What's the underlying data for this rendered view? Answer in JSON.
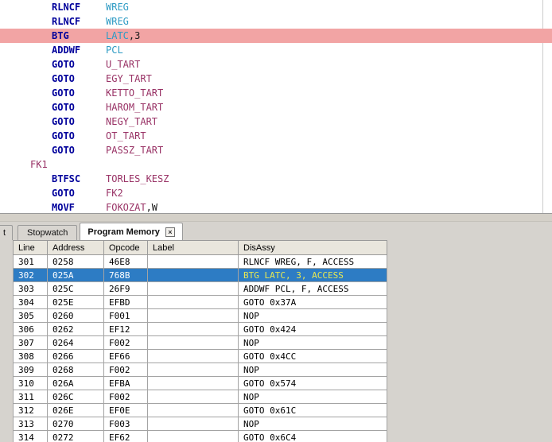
{
  "editor": {
    "lines": [
      {
        "opcode": "RLNCF",
        "operand": "WREG",
        "otype": "reg",
        "highlight": false
      },
      {
        "opcode": "RLNCF",
        "operand": "WREG",
        "otype": "reg",
        "highlight": false
      },
      {
        "opcode": "BTG",
        "operand": "LATC",
        "suffix": ",3",
        "otype": "reg",
        "highlight": true
      },
      {
        "opcode": "ADDWF",
        "operand": "PCL",
        "otype": "reg",
        "highlight": false
      },
      {
        "opcode": "GOTO",
        "operand": "U_TART",
        "otype": "lbl",
        "highlight": false
      },
      {
        "opcode": "GOTO",
        "operand": "EGY_TART",
        "otype": "lbl",
        "highlight": false
      },
      {
        "opcode": "GOTO",
        "operand": "KETTO_TART",
        "otype": "lbl",
        "highlight": false
      },
      {
        "opcode": "GOTO",
        "operand": "HAROM_TART",
        "otype": "lbl",
        "highlight": false
      },
      {
        "opcode": "GOTO",
        "operand": "NEGY_TART",
        "otype": "lbl",
        "highlight": false
      },
      {
        "opcode": "GOTO",
        "operand": "OT_TART",
        "otype": "lbl",
        "highlight": false
      },
      {
        "opcode": "GOTO",
        "operand": "PASSZ_TART",
        "otype": "lbl",
        "highlight": false
      },
      {
        "label": "FK1",
        "highlight": false
      },
      {
        "opcode": "BTFSC",
        "operand": "TORLES_KESZ",
        "otype": "lbl",
        "highlight": false
      },
      {
        "opcode": "GOTO",
        "operand": "FK2",
        "otype": "lbl",
        "highlight": false
      },
      {
        "opcode": "MOVF",
        "operand": "FOKOZAT",
        "suffix": ",W",
        "otype": "lbl",
        "highlight": false
      }
    ]
  },
  "bottom_panel": {
    "tabs": {
      "partial_label": "t",
      "items": [
        {
          "label": "Stopwatch",
          "active": false,
          "closable": false
        },
        {
          "label": "Program Memory",
          "active": true,
          "closable": true
        }
      ],
      "close_glyph": "×"
    },
    "memory_table": {
      "columns": [
        "Line",
        "Address",
        "Opcode",
        "Label",
        "DisAssy"
      ],
      "selected_line": "302",
      "rows": [
        [
          "301",
          "0258",
          "46E8",
          "",
          "RLNCF WREG, F, ACCESS"
        ],
        [
          "302",
          "025A",
          "768B",
          "",
          "BTG LATC, 3, ACCESS"
        ],
        [
          "303",
          "025C",
          "26F9",
          "",
          "ADDWF PCL, F, ACCESS"
        ],
        [
          "304",
          "025E",
          "EFBD",
          "",
          "GOTO 0x37A"
        ],
        [
          "305",
          "0260",
          "F001",
          "",
          "NOP"
        ],
        [
          "306",
          "0262",
          "EF12",
          "",
          "GOTO 0x424"
        ],
        [
          "307",
          "0264",
          "F002",
          "",
          "NOP"
        ],
        [
          "308",
          "0266",
          "EF66",
          "",
          "GOTO 0x4CC"
        ],
        [
          "309",
          "0268",
          "F002",
          "",
          "NOP"
        ],
        [
          "310",
          "026A",
          "EFBA",
          "",
          "GOTO 0x574"
        ],
        [
          "311",
          "026C",
          "F002",
          "",
          "NOP"
        ],
        [
          "312",
          "026E",
          "EF0E",
          "",
          "GOTO 0x61C"
        ],
        [
          "313",
          "0270",
          "F003",
          "",
          "NOP"
        ],
        [
          "314",
          "0272",
          "EF62",
          "",
          "GOTO 0x6C4"
        ]
      ]
    }
  },
  "colors": {
    "opcode": "#00009b",
    "register": "#2e9bc4",
    "symbol": "#993366",
    "highlight_line_bg": "#f2a4a4",
    "selected_row_bg": "#2d7cc4",
    "selected_row_fg": "#ffffff",
    "selected_disassy_fg": "#e8e852",
    "panel_bg": "#d6d3ce"
  }
}
